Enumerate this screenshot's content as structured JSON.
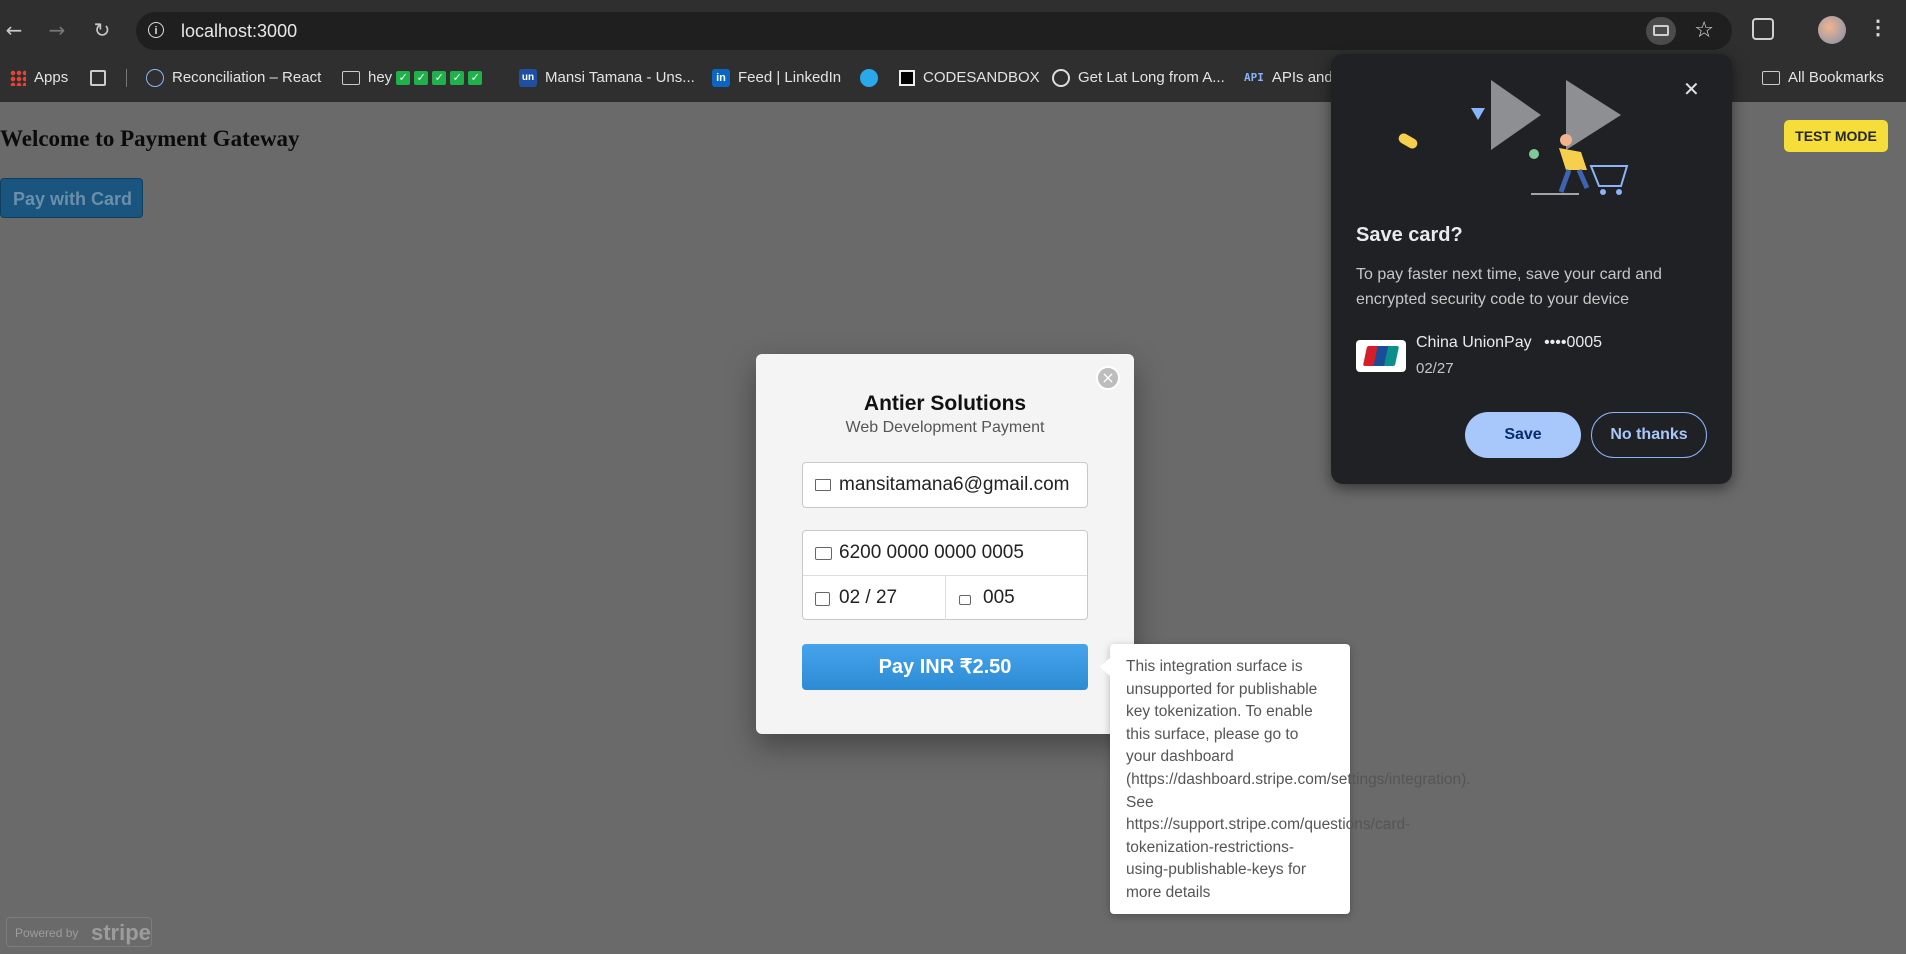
{
  "browser": {
    "url": "localhost:3000",
    "bookmarks": [
      {
        "label": "Apps",
        "icon": "apps-icon"
      },
      {
        "label": "Reconciliation – React",
        "icon": "react-icon"
      },
      {
        "label": "hey",
        "icon": "folder-icon"
      },
      {
        "label": "Mansi Tamana - Uns...",
        "icon": "unstop-icon"
      },
      {
        "label": "Feed | LinkedIn",
        "icon": "linkedin-icon"
      },
      {
        "label": "",
        "icon": "telegram-icon"
      },
      {
        "label": "CODESANDBOX",
        "icon": "codesandbox-icon"
      },
      {
        "label": "Get Lat Long from A...",
        "icon": "geo-icon"
      },
      {
        "label": "APIs and",
        "icon": "api-icon"
      }
    ],
    "all_bookmarks": "All Bookmarks"
  },
  "page": {
    "title": "Welcome to Payment Gateway",
    "pay_with_card": "Pay with Card",
    "test_mode": "TEST MODE",
    "powered_by": "Powered by",
    "powered_brand": "stripe"
  },
  "checkout": {
    "title": "Antier Solutions",
    "subtitle": "Web Development Payment",
    "email": "mansitamana6@gmail.com",
    "card_number": "6200 0000 0000 0005",
    "expiry": "02 / 27",
    "cvc": "005",
    "pay_button": "Pay INR ₹2.50",
    "error_tooltip": "This integration surface is\nunsupported for publishable\nkey tokenization. To enable\nthis surface, please go to\nyour dashboard\n(https://dashboard.stripe.com/settings/integration).\nSee\nhttps://support.stripe.com/questions/card-\ntokenization-restrictions-\nusing-publishable-keys for\nmore details"
  },
  "save_card": {
    "title": "Save card?",
    "description": "To pay faster next time, save your card and encrypted security code to your device",
    "card_brand": "China UnionPay",
    "card_masked": "••••0005",
    "card_expiry": "02/27",
    "save_button": "Save",
    "no_thanks_button": "No thanks"
  },
  "colors": {
    "overlay": "#6a6a6a",
    "pay_button": "#2d8bd4",
    "test_badge": "#f5dd3a",
    "save_button": "#a8c7fa"
  }
}
